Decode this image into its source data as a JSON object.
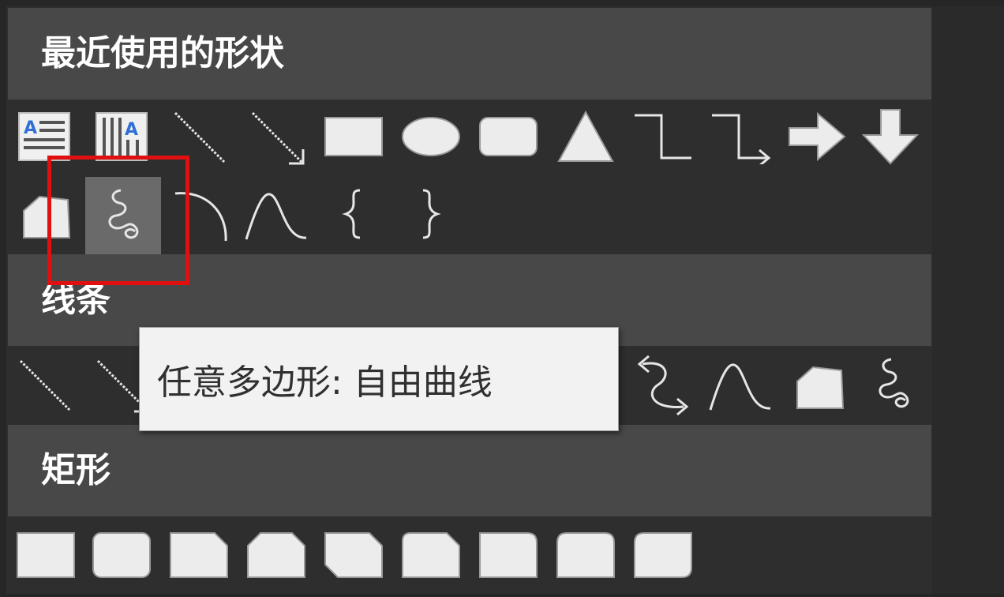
{
  "sections": [
    {
      "title": "最近使用的形状"
    },
    {
      "title": "线条"
    },
    {
      "title": "矩形"
    }
  ],
  "recent_shapes": [
    "horizontal-text-box-icon",
    "vertical-text-box-icon",
    "line-icon",
    "arrow-line-icon",
    "rectangle-icon",
    "oval-icon",
    "rounded-rectangle-icon",
    "triangle-icon",
    "elbow-connector-icon",
    "elbow-arrow-connector-icon",
    "right-arrow-icon",
    "down-arrow-icon",
    "freeform-shape-icon",
    "freeform-scribble-icon",
    "arc-icon",
    "curve-icon",
    "left-brace-icon",
    "right-brace-icon"
  ],
  "line_shapes": [
    "line-icon",
    "arrow-line-icon",
    "curved-double-arrow-connector-icon",
    "curve-icon",
    "freeform-shape-icon",
    "freeform-scribble-icon"
  ],
  "rectangle_shapes": [
    "rectangle-icon",
    "rounded-rectangle-icon",
    "snip-single-corner-rectangle-icon",
    "snip-same-side-rectangle-icon",
    "snip-diagonal-rectangle-icon",
    "snip-round-single-corner-rectangle-icon",
    "round-single-corner-rectangle-icon",
    "round-same-side-rectangle-icon",
    "round-diagonal-rectangle-icon"
  ],
  "hovered_shape": "freeform-scribble-icon",
  "tooltip": {
    "text": "任意多边形: 自由曲线"
  },
  "colors": {
    "background": "#2e2e2e",
    "section_header": "#484848",
    "icon": "#e6e6e6",
    "hover": "#6a6a6a",
    "highlight": "#e01010",
    "tooltip_bg": "#f2f2f2"
  }
}
